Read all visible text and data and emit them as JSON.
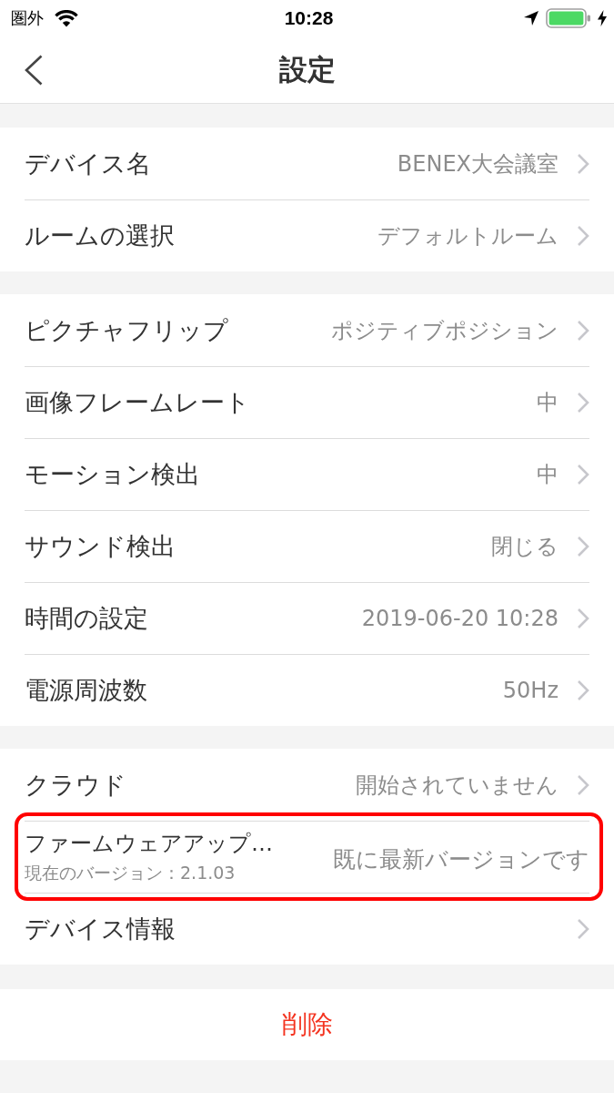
{
  "status_bar": {
    "carrier": "圏外",
    "time": "10:28"
  },
  "nav_bar": {
    "title": "設定"
  },
  "groups": [
    {
      "items": [
        {
          "kind": "nav",
          "label": "デバイス名",
          "value": "BENEX大会議室",
          "highlighted": false
        },
        {
          "kind": "nav",
          "label": "ルームの選択",
          "value": "デフォルトルーム",
          "highlighted": false
        }
      ]
    },
    {
      "items": [
        {
          "kind": "nav",
          "label": "ピクチャフリップ",
          "value": "ポジティブポジション",
          "highlighted": false
        },
        {
          "kind": "nav",
          "label": "画像フレームレート",
          "value": "中",
          "highlighted": false
        },
        {
          "kind": "nav",
          "label": "モーション検出",
          "value": "中",
          "highlighted": false
        },
        {
          "kind": "nav",
          "label": "サウンド検出",
          "value": "閉じる",
          "highlighted": false
        },
        {
          "kind": "nav",
          "label": "時間の設定",
          "value": "2019-06-20 10:28",
          "highlighted": false
        },
        {
          "kind": "nav",
          "label": "電源周波数",
          "value": "50Hz",
          "highlighted": false
        }
      ]
    },
    {
      "items": [
        {
          "kind": "nav",
          "label": "クラウド",
          "value": "開始されていません",
          "highlighted": false
        },
        {
          "kind": "info",
          "label": "ファームウェアアップ…",
          "sublabel": "現在のバージョン：2.1.03",
          "value": "既に最新バージョンです",
          "highlighted": true
        },
        {
          "kind": "nav",
          "label": "デバイス情報",
          "highlighted": false
        }
      ]
    }
  ],
  "delete_button": {
    "label": "削除"
  }
}
